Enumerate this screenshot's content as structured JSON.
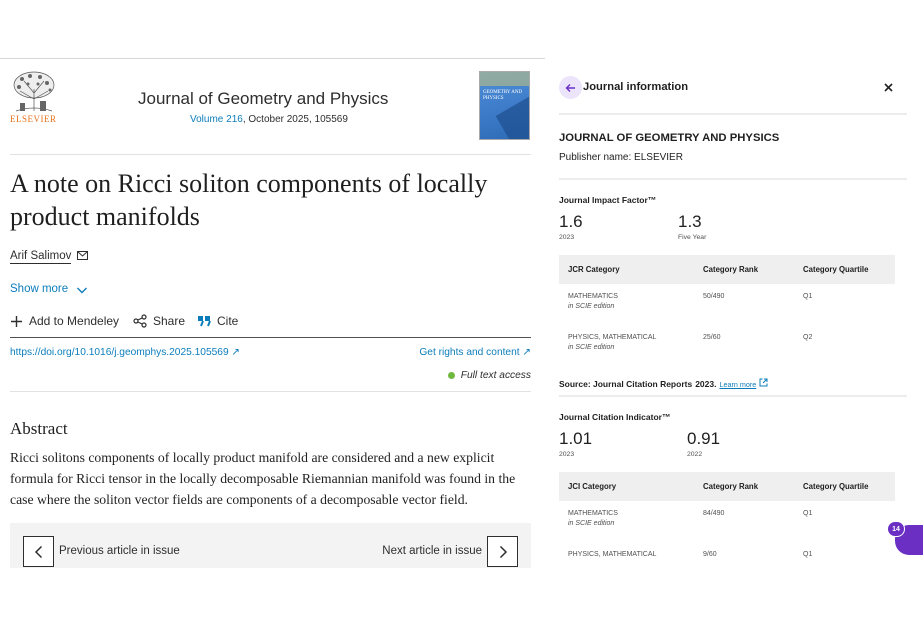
{
  "publisher_logo_text": "ELSEVIER",
  "journal": {
    "title": "Journal of Geometry and Physics",
    "volume": "Volume 216",
    "issue_rest": ", October 2025, 105569",
    "cover_text": "GEOMETRY AND PHYSICS"
  },
  "article": {
    "title": "A note on Ricci soliton components of locally product manifolds",
    "author": "Arif Salimov",
    "show_more": "Show more",
    "actions": {
      "mendeley": "Add to Mendeley",
      "share": "Share",
      "cite": "Cite"
    },
    "doi": "https://doi.org/10.1016/j.geomphys.2025.105569",
    "rights": "Get rights and content",
    "access": "Full text access",
    "abstract_heading": "Abstract",
    "abstract_text": "Ricci solitons components of locally product manifold are considered and a new explicit formula for Ricci tensor in the locally decomposable Riemannian manifold was found in the case where the soliton vector fields are components of a decomposable vector field.",
    "prev_label": "Previous article in issue",
    "next_label": "Next article in issue"
  },
  "panel": {
    "title": "Journal information",
    "journal_name": "JOURNAL OF GEOMETRY AND PHYSICS",
    "publisher": "Publisher name: ELSEVIER",
    "jif": {
      "heading": "Journal Impact Factor™",
      "value1": "1.6",
      "label1": "2023",
      "value2": "1.3",
      "label2": "Five Year"
    },
    "jcr_table": {
      "headers": [
        "JCR Category",
        "Category Rank",
        "Category Quartile"
      ],
      "rows": [
        {
          "category": "MATHEMATICS",
          "edition": "in SCIE edition",
          "rank": "50/490",
          "quartile": "Q1"
        },
        {
          "category": "PHYSICS, MATHEMATICAL",
          "edition": "in SCIE edition",
          "rank": "25/60",
          "quartile": "Q2"
        }
      ]
    },
    "source": "Source: Journal Citation Reports",
    "source_year": "2023.",
    "learn_more": "Learn more",
    "jci": {
      "heading": "Journal Citation Indicator™",
      "value1": "1.01",
      "label1": "2023",
      "value2": "0.91",
      "label2": "2022"
    },
    "jci_table": {
      "headers": [
        "JCI Category",
        "Category Rank",
        "Category Quartile"
      ],
      "rows": [
        {
          "category": "MATHEMATICS",
          "edition": "in SCIE edition",
          "rank": "84/490",
          "quartile": "Q1"
        },
        {
          "category": "PHYSICS, MATHEMATICAL",
          "rank": "9/60",
          "quartile": "Q1"
        }
      ]
    }
  },
  "chat_badge_count": "14",
  "colors": {
    "link": "#0c7dbb",
    "elsevier_orange": "#e9711c",
    "access_green": "#6fb83f",
    "accent_purple": "#6b2fc4"
  }
}
